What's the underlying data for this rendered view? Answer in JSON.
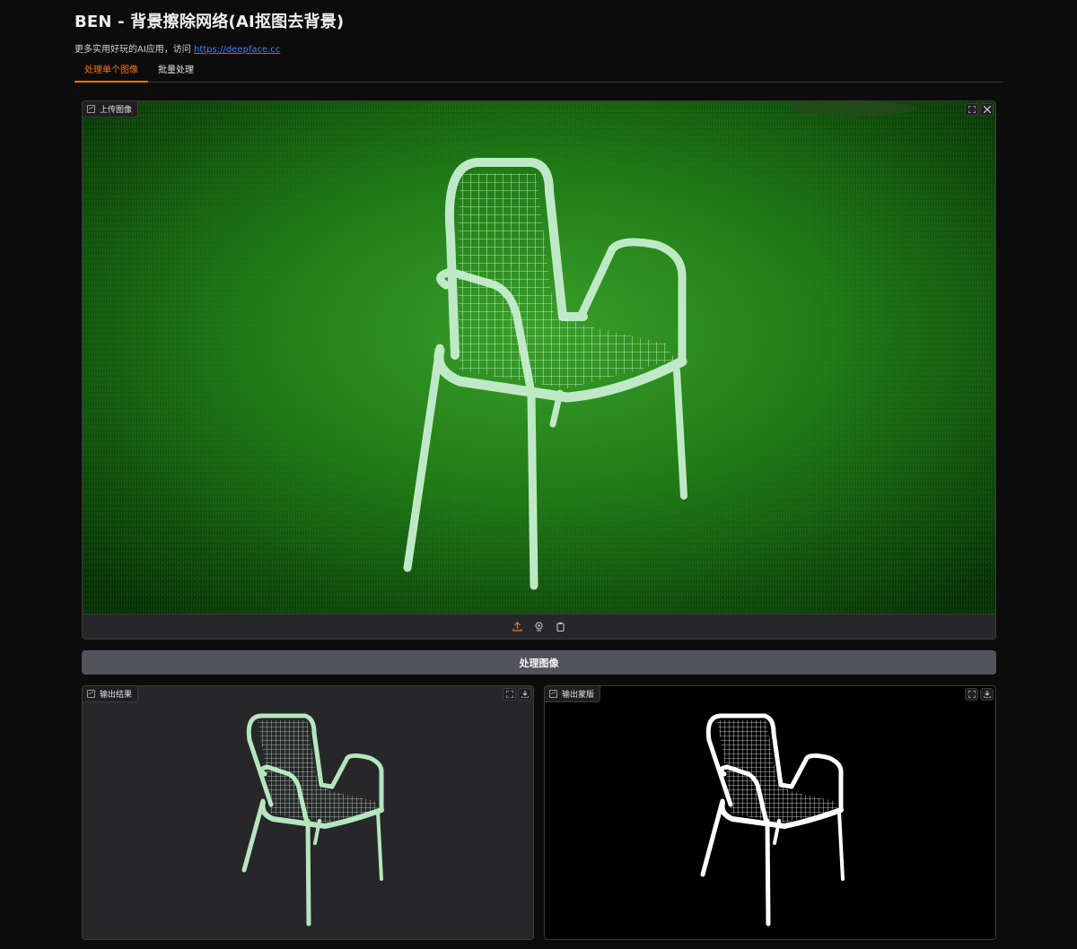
{
  "app": {
    "title": "BEN - 背景擦除网络(AI抠图去背景)",
    "subtitle_prefix": "更多实用好玩的AI应用，访问",
    "subtitle_link": "https://deepface.cc"
  },
  "tabs": [
    {
      "label": "处理单个图像",
      "active": true
    },
    {
      "label": "批量处理",
      "active": false
    }
  ],
  "upload_panel": {
    "label": "上传图像",
    "fullscreen_icon": "fullscreen-icon",
    "close_icon": "close-icon",
    "toolbar_icons": [
      "upload-icon",
      "webcam-icon",
      "clipboard-icon"
    ]
  },
  "process_button": {
    "label": "处理图像"
  },
  "result_panel": {
    "label": "输出结果",
    "icons": [
      "fullscreen-icon",
      "download-icon"
    ]
  },
  "mask_panel": {
    "label": "输出蒙版",
    "icons": [
      "fullscreen-icon",
      "download-icon"
    ]
  },
  "colors": {
    "accent": "#f97316",
    "link": "#3b82f6",
    "chair": "#b6e6bf",
    "grass": "#1f7a16"
  }
}
